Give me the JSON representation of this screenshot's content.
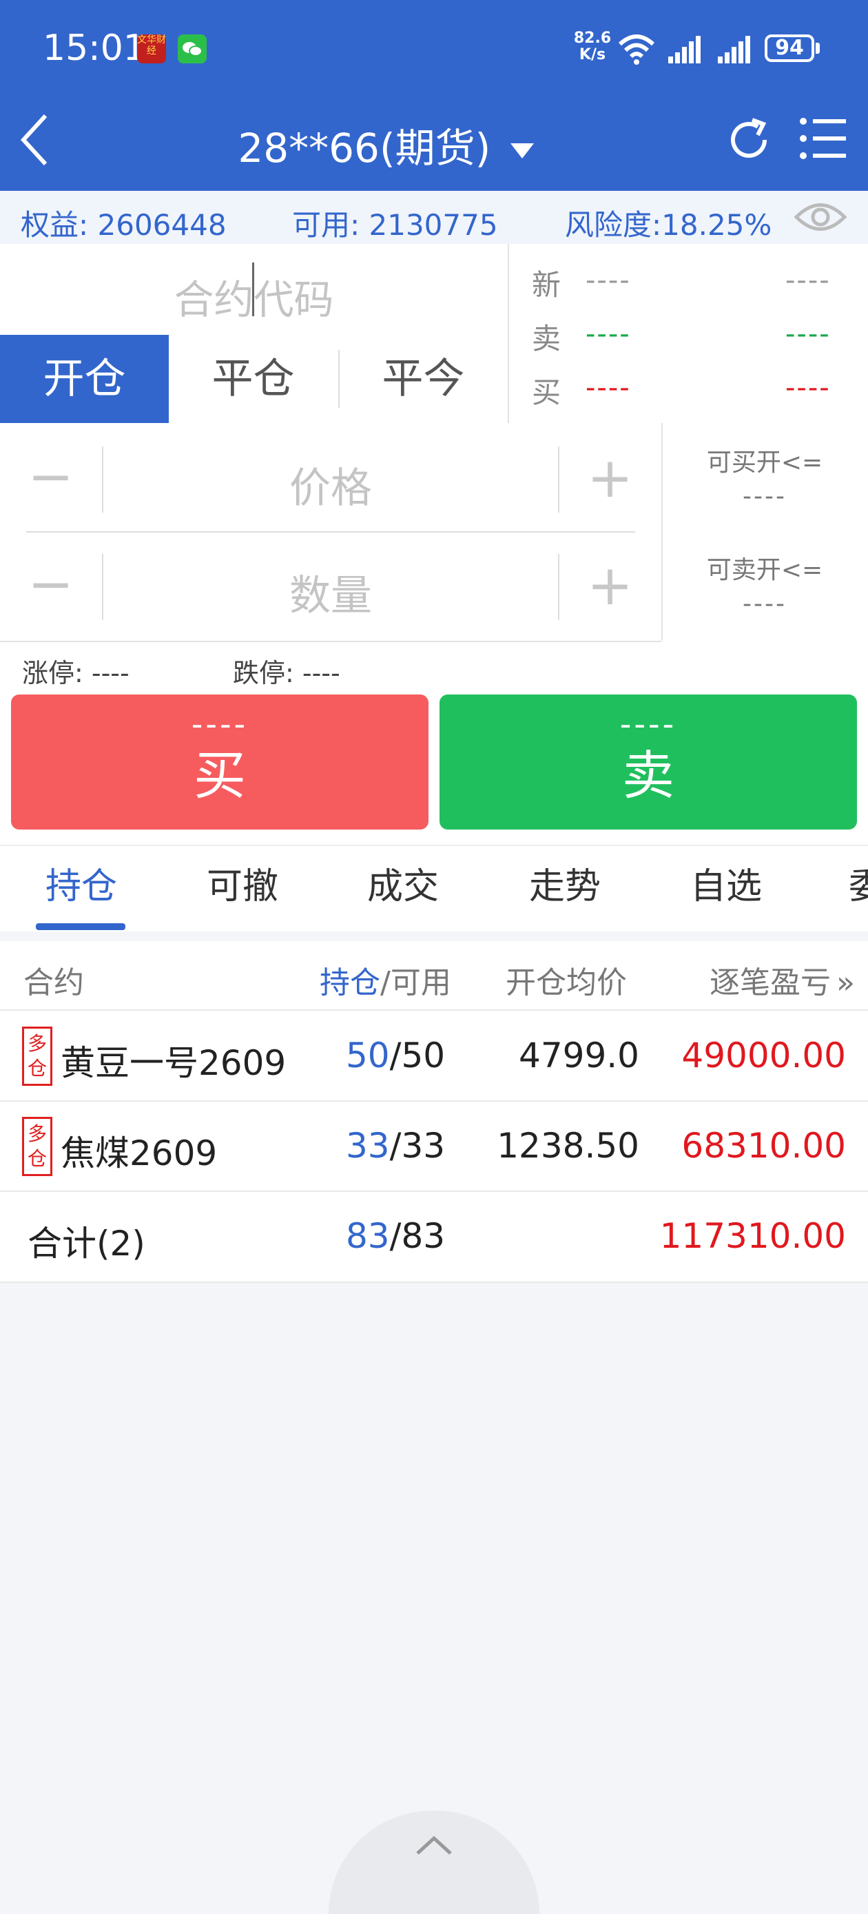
{
  "status_bar": {
    "time": "15:01",
    "net_speed_value": "82.6",
    "net_speed_unit": "K/s",
    "battery": "94",
    "app_icon_text": "文华财经"
  },
  "nav": {
    "title": "28**66(期货)",
    "dropdown_icon": "triangle-down-icon",
    "back_icon": "chevron-left-icon",
    "refresh_icon": "refresh-icon",
    "menu_icon": "menu-list-icon"
  },
  "account": {
    "equity": "权益: 2606448",
    "available": "可用: 2130775",
    "risk": "风险度:18.25%"
  },
  "order": {
    "code_placeholder": "合约代码",
    "tabs": [
      "开仓",
      "平仓",
      "平今"
    ],
    "price_placeholder": "价格",
    "qty_placeholder": "数量",
    "minus": "−",
    "plus": "+",
    "can_buy_label": "可买开<=",
    "can_buy_value": "----",
    "can_sell_label": "可卖开<=",
    "can_sell_value": "----",
    "limit_up": "涨停: ----",
    "limit_down": "跌停: ----"
  },
  "quote": {
    "rows": [
      {
        "label": "新",
        "v1": "----",
        "v2": "----",
        "color": "#999999"
      },
      {
        "label": "卖",
        "v1": "----",
        "v2": "----",
        "color": "#18a84a"
      },
      {
        "label": "买",
        "v1": "----",
        "v2": "----",
        "color": "#e0181e"
      }
    ]
  },
  "trade_buttons": {
    "buy_price": "----",
    "buy_label": "买",
    "sell_price": "----",
    "sell_label": "卖"
  },
  "bottom_tabs": [
    "持仓",
    "可撤",
    "成交",
    "走势",
    "自选",
    "委"
  ],
  "positions": {
    "headers": {
      "contract": "合约",
      "hold": "持仓",
      "slash_avail": "/可用",
      "avg_price": "开仓均价",
      "pnl": "逐笔盈亏",
      "more": "»"
    },
    "badge_top": "多",
    "badge_bottom": "仓",
    "rows": [
      {
        "name": "黄豆一号2609",
        "hold": "50",
        "avail": "/50",
        "avg": "4799.0",
        "pnl": "49000.00"
      },
      {
        "name": "焦煤2609",
        "hold": "33",
        "avail": "/33",
        "avg": "1238.50",
        "pnl": "68310.00"
      }
    ],
    "total": {
      "label": "合计(2)",
      "hold": "83",
      "avail": "/83",
      "pnl": "117310.00"
    }
  }
}
